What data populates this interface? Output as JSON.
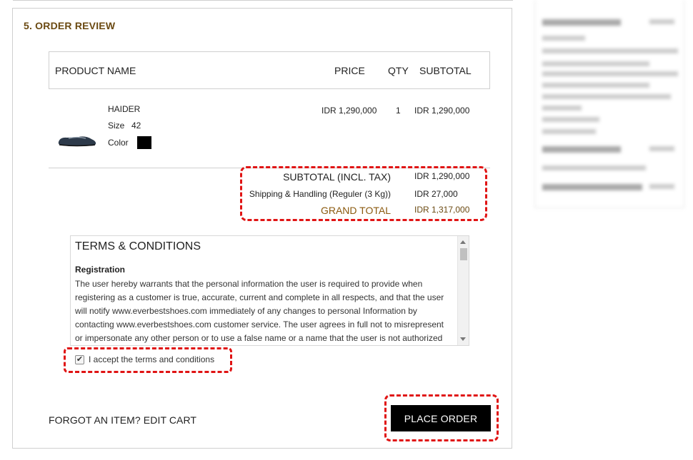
{
  "section": {
    "title": "5. ORDER REVIEW"
  },
  "table": {
    "headers": {
      "name": "PRODUCT NAME",
      "price": "PRICE",
      "qty": "QTY",
      "subtotal": "SUBTOTAL"
    },
    "rows": [
      {
        "name": "HAIDER",
        "size_label": "Size",
        "size": "42",
        "color_label": "Color",
        "color": "#000000",
        "price": "IDR 1,290,000",
        "qty": "1",
        "subtotal": "IDR 1,290,000"
      }
    ]
  },
  "totals": {
    "subtotal_label": "SUBTOTAL (INCL. TAX)",
    "subtotal_value": "IDR 1,290,000",
    "shipping_label": "Shipping & Handling (Reguler (3 Kg))",
    "shipping_value": "IDR 27,000",
    "grand_label": "GRAND TOTAL",
    "grand_value": "IDR 1,317,000"
  },
  "terms": {
    "title": "TERMS & CONDITIONS",
    "subtitle": "Registration",
    "body": "The user hereby warrants that the personal information the user is required to provide when registering as a customer is true, accurate, current and complete in all respects, and that the user will notify www.everbestshoes.com immediately of any changes to personal Information by contacting www.everbestshoes.com customer service. The user agrees in full not to misrepresent or impersonate any other person or to use a false name or a name that the user is not authorized"
  },
  "accept": {
    "label": "I accept the terms and conditions",
    "checked": true
  },
  "footer": {
    "forgot_label": "FORGOT AN ITEM? EDIT CART",
    "place_order_label": "PLACE ORDER"
  },
  "colors": {
    "section_title": "#6b4a12",
    "grand_total": "#8b5a0f",
    "highlight": "#e01414",
    "button_bg": "#000000"
  }
}
